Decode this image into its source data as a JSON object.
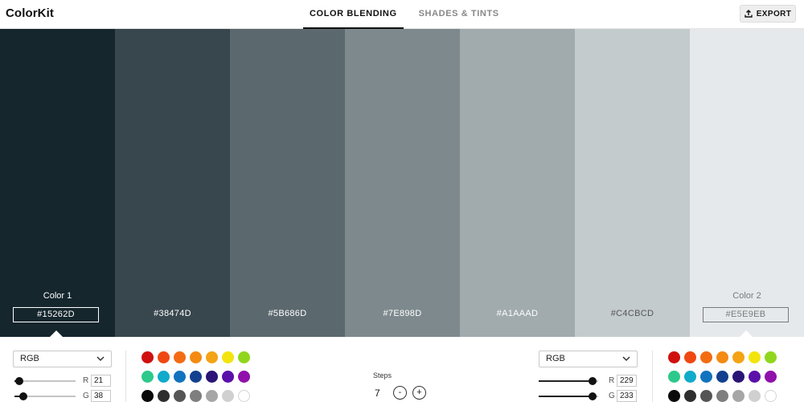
{
  "app": {
    "logo": "ColorKit"
  },
  "header": {
    "tabs": [
      {
        "label": "COLOR BLENDING",
        "active": true
      },
      {
        "label": "SHADES & TINTS",
        "active": false
      }
    ],
    "export_label": "EXPORT"
  },
  "swatches": [
    {
      "hex": "#15262D",
      "label": "Color 1",
      "editable": true,
      "text_color": "#ffffff"
    },
    {
      "hex": "#38474D",
      "label": "",
      "editable": false,
      "text_color": "#ffffff"
    },
    {
      "hex": "#5B686D",
      "label": "",
      "editable": false,
      "text_color": "#ffffff"
    },
    {
      "hex": "#7E898D",
      "label": "",
      "editable": false,
      "text_color": "#ffffff"
    },
    {
      "hex": "#A1AAAD",
      "label": "",
      "editable": false,
      "text_color": "#ffffff"
    },
    {
      "hex": "#C4CBCD",
      "label": "",
      "editable": false,
      "text_color": "#555555"
    },
    {
      "hex": "#E5E9EB",
      "label": "Color 2",
      "editable": true,
      "text_color": "#7a7a7a"
    }
  ],
  "color1": {
    "mode": "RGB",
    "channels": [
      {
        "name": "R",
        "value": "21",
        "level": 0.08
      },
      {
        "name": "G",
        "value": "38",
        "level": 0.15
      }
    ]
  },
  "color2": {
    "mode": "RGB",
    "channels": [
      {
        "name": "R",
        "value": "229",
        "level": 0.9
      },
      {
        "name": "G",
        "value": "233",
        "level": 0.91
      }
    ]
  },
  "steps": {
    "label": "Steps",
    "value": "7",
    "minus": "-",
    "plus": "+"
  },
  "palette": [
    "#d0100f",
    "#f04812",
    "#f36c12",
    "#f48a12",
    "#f4a314",
    "#f2e40c",
    "#8fd61c",
    "#2dc98b",
    "#10aacb",
    "#1172be",
    "#123f8e",
    "#2a1577",
    "#5b10aa",
    "#8f10aa",
    "#0a0a0a",
    "#2e2e2e",
    "#555555",
    "#7e7e7e",
    "#a6a6a6",
    "#d0d0d0",
    "#ffffff"
  ],
  "icons": {
    "export": "upload-icon",
    "dropdown": "chevron-down-icon"
  }
}
